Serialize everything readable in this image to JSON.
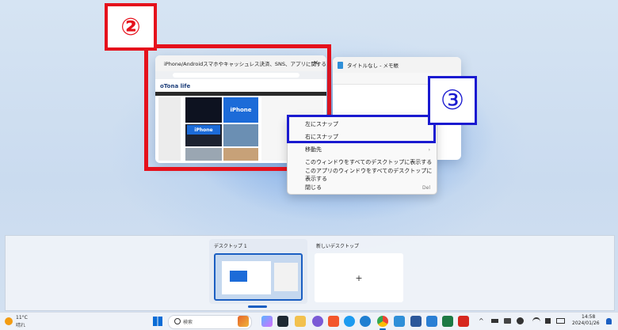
{
  "window1": {
    "title": "iPhone/Androidスマホやキャッシュレス決済、SNS、アプリに関する…",
    "close": "✕",
    "site": "oTona life",
    "promo": "iPhone"
  },
  "window2": {
    "title": "タイトルなし - メモ帳"
  },
  "annotations": {
    "red": "②",
    "blue": "③"
  },
  "context_menu": {
    "items": [
      {
        "label": "左にスナップ"
      },
      {
        "label": "右にスナップ"
      },
      {
        "label": "移動先",
        "suffix": "›"
      },
      {
        "label": "このウィンドウをすべてのデスクトップに表示する"
      },
      {
        "label": "このアプリのウィンドウをすべてのデスクトップに表示する"
      },
      {
        "label": "閉じる",
        "suffix": "Del"
      }
    ]
  },
  "desktops": {
    "desktop1": "デスクトップ 1",
    "new_desktop": "新しいデスクトップ",
    "add": "+"
  },
  "taskbar": {
    "weather_temp": "11°C",
    "weather_desc": "晴れ",
    "search_placeholder": "検索",
    "time": "14:58",
    "date": "2024/01/26",
    "tray_chevron": "^"
  },
  "colors": {
    "annotation_red": "#e5111c",
    "annotation_blue": "#1a1ad0",
    "accent": "#0067c0"
  }
}
